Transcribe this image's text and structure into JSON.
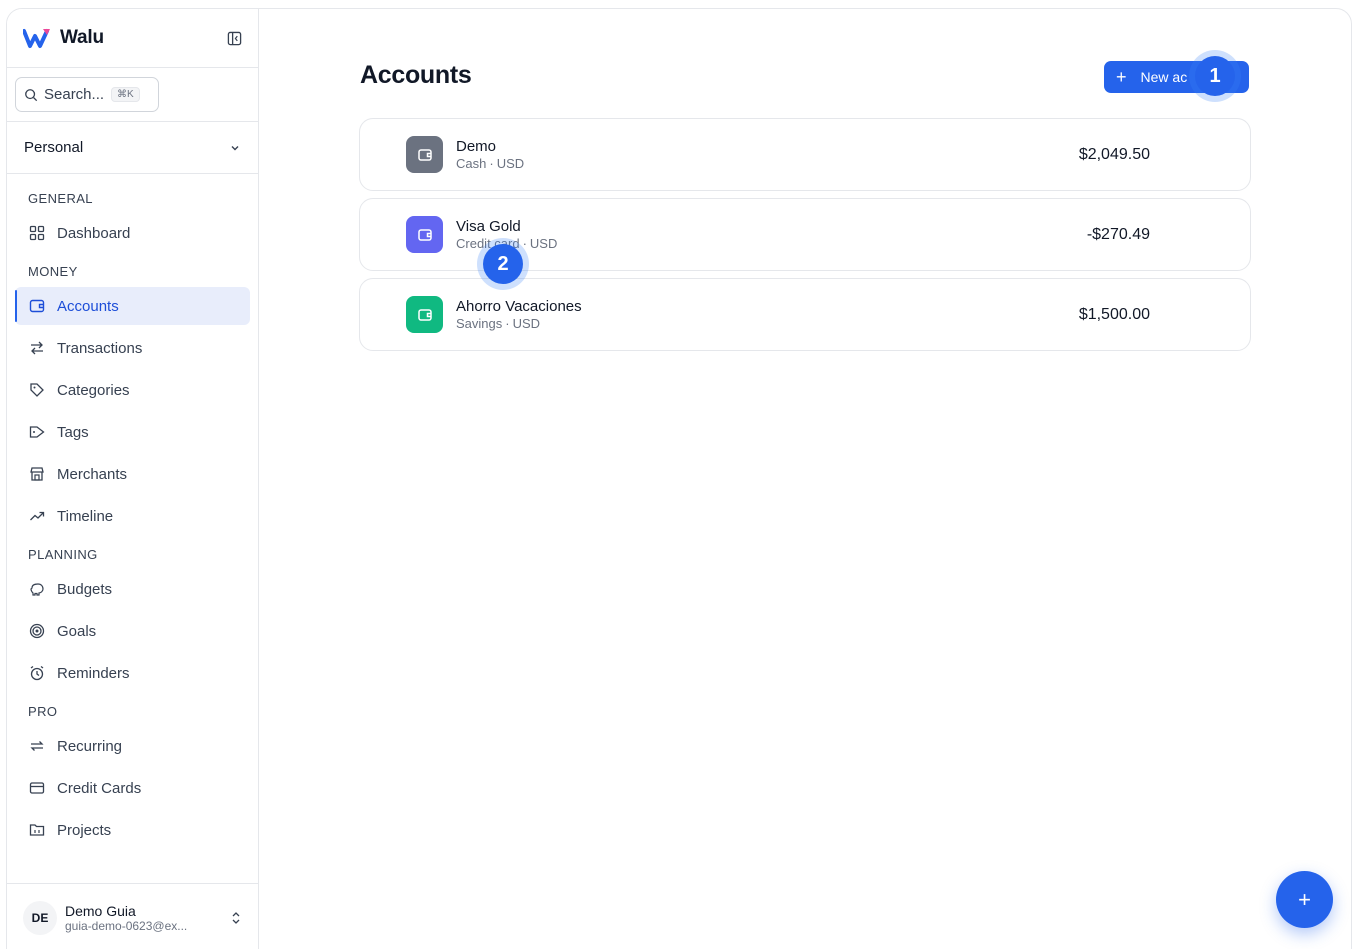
{
  "brand": {
    "name": "Walu"
  },
  "search": {
    "placeholder": "Search...",
    "shortcut": "⌘K"
  },
  "workspace": {
    "selected": "Personal"
  },
  "sidebar": {
    "sections": [
      {
        "label": "GENERAL",
        "items": [
          {
            "label": "Dashboard",
            "icon": "grid-icon"
          }
        ]
      },
      {
        "label": "MONEY",
        "items": [
          {
            "label": "Accounts",
            "icon": "wallet-icon",
            "active": true
          },
          {
            "label": "Transactions",
            "icon": "arrows-icon"
          },
          {
            "label": "Categories",
            "icon": "tags-icon"
          },
          {
            "label": "Tags",
            "icon": "tag-icon"
          },
          {
            "label": "Merchants",
            "icon": "store-icon"
          },
          {
            "label": "Timeline",
            "icon": "trend-icon"
          }
        ]
      },
      {
        "label": "PLANNING",
        "items": [
          {
            "label": "Budgets",
            "icon": "piggy-bank-icon"
          },
          {
            "label": "Goals",
            "icon": "target-icon"
          },
          {
            "label": "Reminders",
            "icon": "alarm-icon"
          }
        ]
      },
      {
        "label": "PRO",
        "items": [
          {
            "label": "Recurring",
            "icon": "repeat-icon"
          },
          {
            "label": "Credit Cards",
            "icon": "credit-card-icon"
          },
          {
            "label": "Projects",
            "icon": "folder-icon"
          }
        ]
      }
    ]
  },
  "user": {
    "initials": "DE",
    "name": "Demo Guia",
    "email": "guia-demo-0623@ex..."
  },
  "main": {
    "title": "Accounts",
    "new_button_label": "New ac",
    "accounts": [
      {
        "name": "Demo",
        "type": "Cash",
        "currency": "USD",
        "amount": "$2,049.50",
        "color": "#6b7280"
      },
      {
        "name": "Visa Gold",
        "type": "Credit card",
        "currency": "USD",
        "amount": "-$270.49",
        "color": "#6366f1"
      },
      {
        "name": "Ahorro Vacaciones",
        "type": "Savings",
        "currency": "USD",
        "amount": "$1,500.00",
        "color": "#10b981"
      }
    ]
  },
  "badges": [
    "1",
    "2"
  ],
  "colors": {
    "accent": "#2563eb",
    "active_bg": "#e8edfb"
  }
}
